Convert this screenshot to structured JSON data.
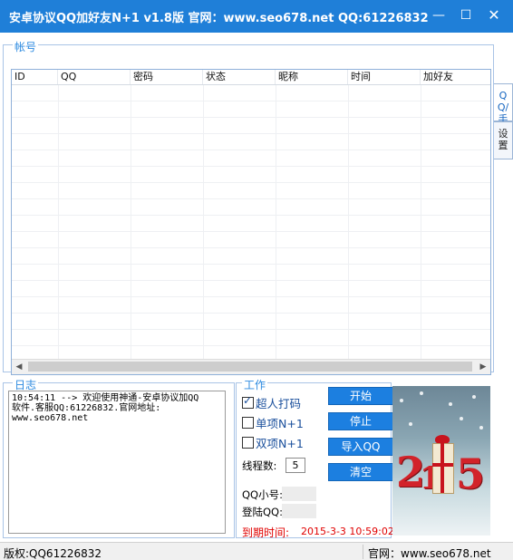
{
  "window": {
    "title": "安卓协议QQ加好友N+1 v1.8版  官网：www.seo678.net  QQ:61226832",
    "minimize": "—",
    "maximize": "☐",
    "close": "✕"
  },
  "tabs": [
    {
      "label": "QQ/手",
      "active": true
    },
    {
      "label": "设置",
      "active": false
    }
  ],
  "accounts": {
    "group_title": "帐号",
    "columns": [
      "ID",
      "QQ",
      "密码",
      "状态",
      "昵称",
      "时间",
      "加好友"
    ],
    "rows": []
  },
  "log": {
    "group_title": "日志",
    "text": "10:54:11 --> 欢迎使用神通-安卓协议加QQ\n软件.客服QQ:61226832.官网地址:\nwww.seo678.net"
  },
  "work": {
    "group_title": "工作",
    "options": [
      {
        "label": "超人打码",
        "checked": true
      },
      {
        "label": "单项N+1",
        "checked": false
      },
      {
        "label": "双项N+1",
        "checked": false
      }
    ],
    "threads_label": "线程数:",
    "threads_value": "5",
    "qq_small_label": "QQ小号:",
    "login_qq_label": "登陆QQ:",
    "expiry_label": "到期时间:",
    "expiry_value": "2015-3-3 10:59:02"
  },
  "buttons": {
    "start": "开始",
    "stop": "停止",
    "import": "导入QQ",
    "clear": "清空"
  },
  "promo": {
    "digits": [
      "2",
      "1",
      "5"
    ]
  },
  "status": {
    "copyright": "版权:QQ61226832",
    "site": "官网：www.seo678.net"
  },
  "colors": {
    "title_bar": "#1f7fd8",
    "button": "#1c7fe0",
    "group_title": "#2c8ae0",
    "expiry": "#e00000"
  }
}
